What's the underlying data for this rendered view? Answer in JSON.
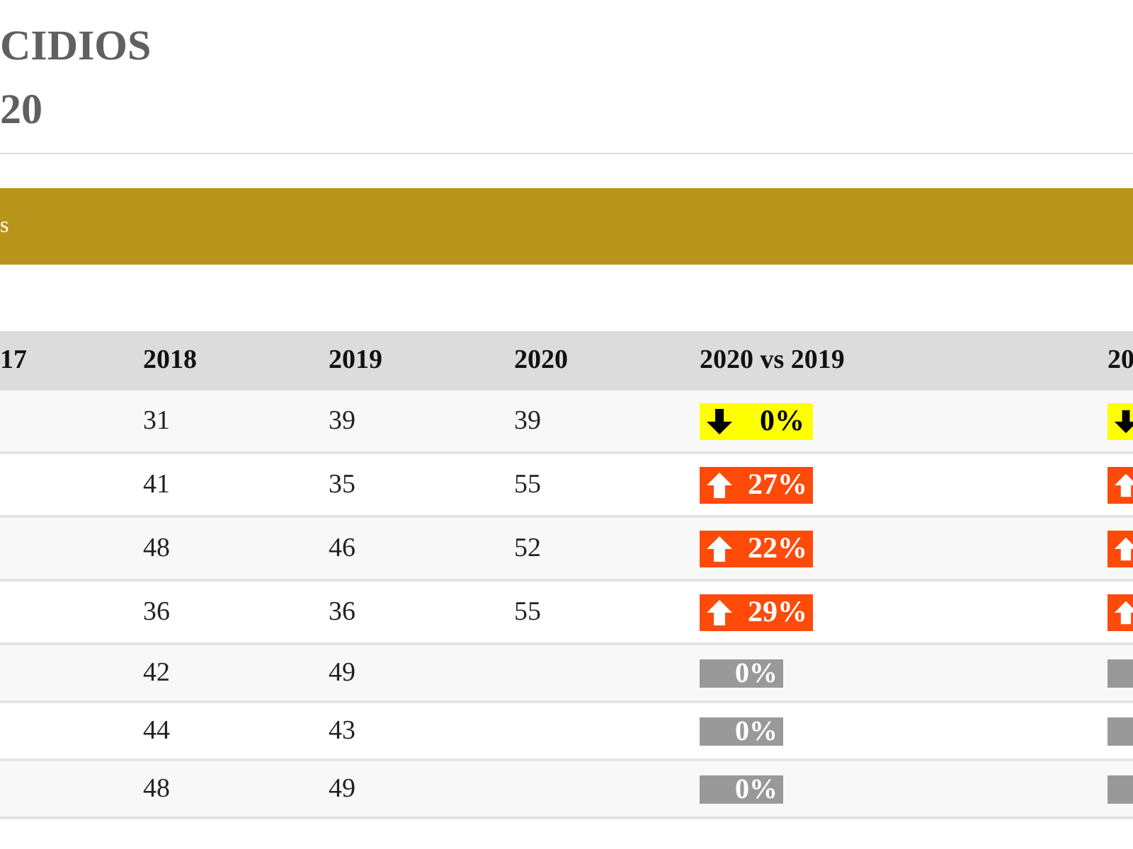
{
  "title_lines": [
    "CIDIOS",
    "20"
  ],
  "banner": {
    "text": "s"
  },
  "table": {
    "columns": [
      "17",
      "2018",
      "2019",
      "2020",
      "2020 vs 2019",
      "20"
    ],
    "rows": [
      {
        "cells": [
          "",
          "31",
          "39",
          "39"
        ],
        "change": {
          "kind": "down",
          "text": "0%"
        },
        "change_2": {
          "kind": "down"
        }
      },
      {
        "cells": [
          "",
          "41",
          "35",
          "55"
        ],
        "change": {
          "kind": "up",
          "text": "27%"
        },
        "change_2": {
          "kind": "up"
        }
      },
      {
        "cells": [
          "",
          "48",
          "46",
          "52"
        ],
        "change": {
          "kind": "up",
          "text": "22%"
        },
        "change_2": {
          "kind": "up"
        }
      },
      {
        "cells": [
          "",
          "36",
          "36",
          "55"
        ],
        "change": {
          "kind": "up",
          "text": "29%"
        },
        "change_2": {
          "kind": "up"
        }
      },
      {
        "cells": [
          "",
          "42",
          "49",
          ""
        ],
        "change": {
          "kind": "none",
          "text": "0%"
        },
        "change_2": {
          "kind": "none"
        }
      },
      {
        "cells": [
          "",
          "44",
          "43",
          ""
        ],
        "change": {
          "kind": "none",
          "text": "0%"
        },
        "change_2": {
          "kind": "none"
        }
      },
      {
        "cells": [
          "",
          "48",
          "49",
          ""
        ],
        "change": {
          "kind": "none",
          "text": "0%"
        },
        "change_2": {
          "kind": "none"
        }
      }
    ]
  }
}
